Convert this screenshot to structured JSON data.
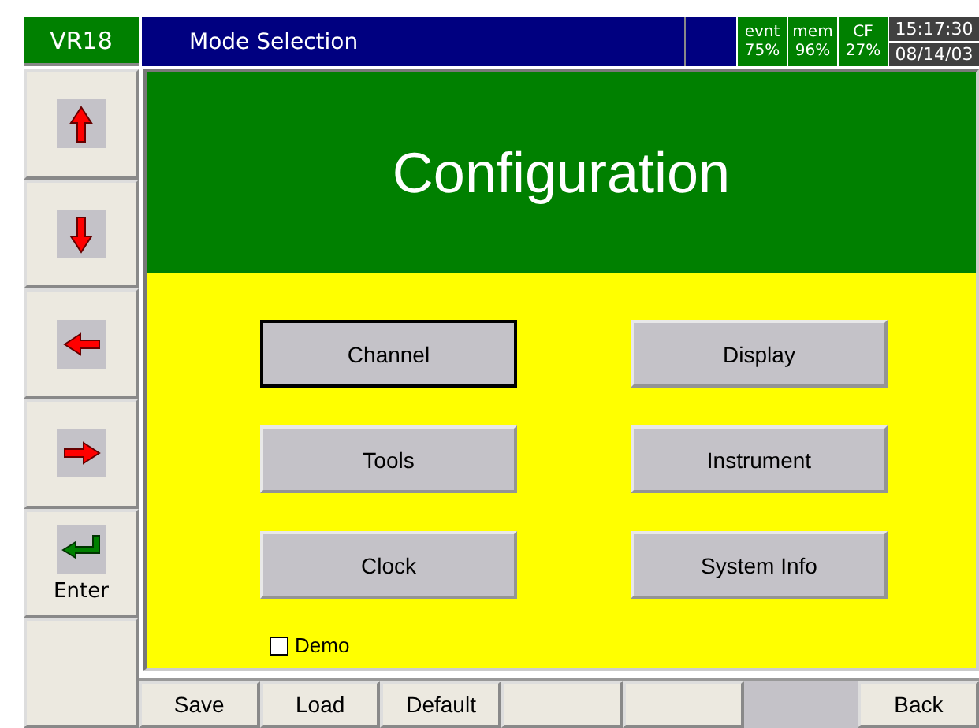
{
  "header": {
    "unit": "VR18",
    "title": "Mode Selection",
    "stats": [
      {
        "label": "evnt",
        "value": "75%"
      },
      {
        "label": "mem",
        "value": "96%"
      },
      {
        "label": "CF",
        "value": "27%"
      }
    ],
    "time": "15:17:30",
    "date": "08/14/03"
  },
  "side_keys": [
    {
      "kind": "up"
    },
    {
      "kind": "down"
    },
    {
      "kind": "left"
    },
    {
      "kind": "right"
    },
    {
      "kind": "enter",
      "label": "Enter"
    },
    {
      "kind": "blank"
    }
  ],
  "heading": "Configuration",
  "menu": [
    {
      "label": "Channel",
      "selected": true
    },
    {
      "label": "Display",
      "selected": false
    },
    {
      "label": "Tools",
      "selected": false
    },
    {
      "label": "Instrument",
      "selected": false
    },
    {
      "label": "Clock",
      "selected": false
    },
    {
      "label": "System Info",
      "selected": false
    }
  ],
  "demo": {
    "label": "Demo",
    "checked": false
  },
  "soft_keys": [
    {
      "label": "Save",
      "disabled": false
    },
    {
      "label": "Load",
      "disabled": false
    },
    {
      "label": "Default",
      "disabled": false
    },
    {
      "disabled": false
    },
    {
      "disabled": false
    },
    {
      "disabled": true
    },
    {
      "label": "Back",
      "disabled": false
    }
  ]
}
